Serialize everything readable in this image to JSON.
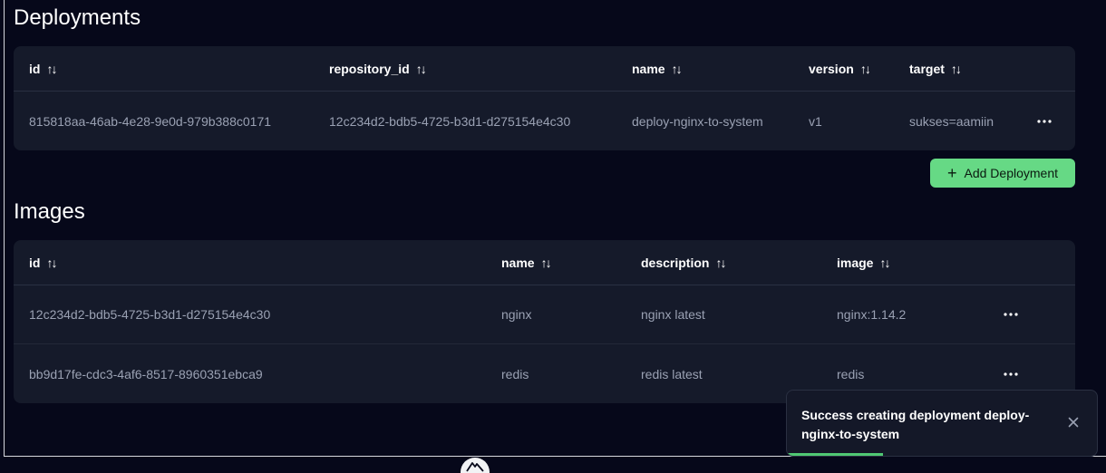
{
  "deployments": {
    "title": "Deployments",
    "columns": [
      "id",
      "repository_id",
      "name",
      "version",
      "target"
    ],
    "sort_icon": "sort-arrows-icon",
    "rows": [
      {
        "id": "815818aa-46ab-4e28-9e0d-979b388c0171",
        "repository_id": "12c234d2-bdb5-4725-b3d1-d275154e4c30",
        "name": "deploy-nginx-to-system",
        "version": "v1",
        "target": "sukses=aamiin"
      }
    ],
    "add_button_label": "Add Deployment"
  },
  "images": {
    "title": "Images",
    "columns": [
      "id",
      "name",
      "description",
      "image"
    ],
    "rows": [
      {
        "id": "12c234d2-bdb5-4725-b3d1-d275154e4c30",
        "name": "nginx",
        "description": "nginx latest",
        "image": "nginx:1.14.2"
      },
      {
        "id": "bb9d17fe-cdc3-4af6-8517-8960351ebca9",
        "name": "redis",
        "description": "redis latest",
        "image": "redis"
      }
    ]
  },
  "toast": {
    "message": "Success creating deployment deploy-nginx-to-system",
    "progress": 0.31,
    "accent": "#4fc873"
  },
  "colors": {
    "background": "#06081a",
    "panel": "#151a2a",
    "accent": "#66d985"
  }
}
